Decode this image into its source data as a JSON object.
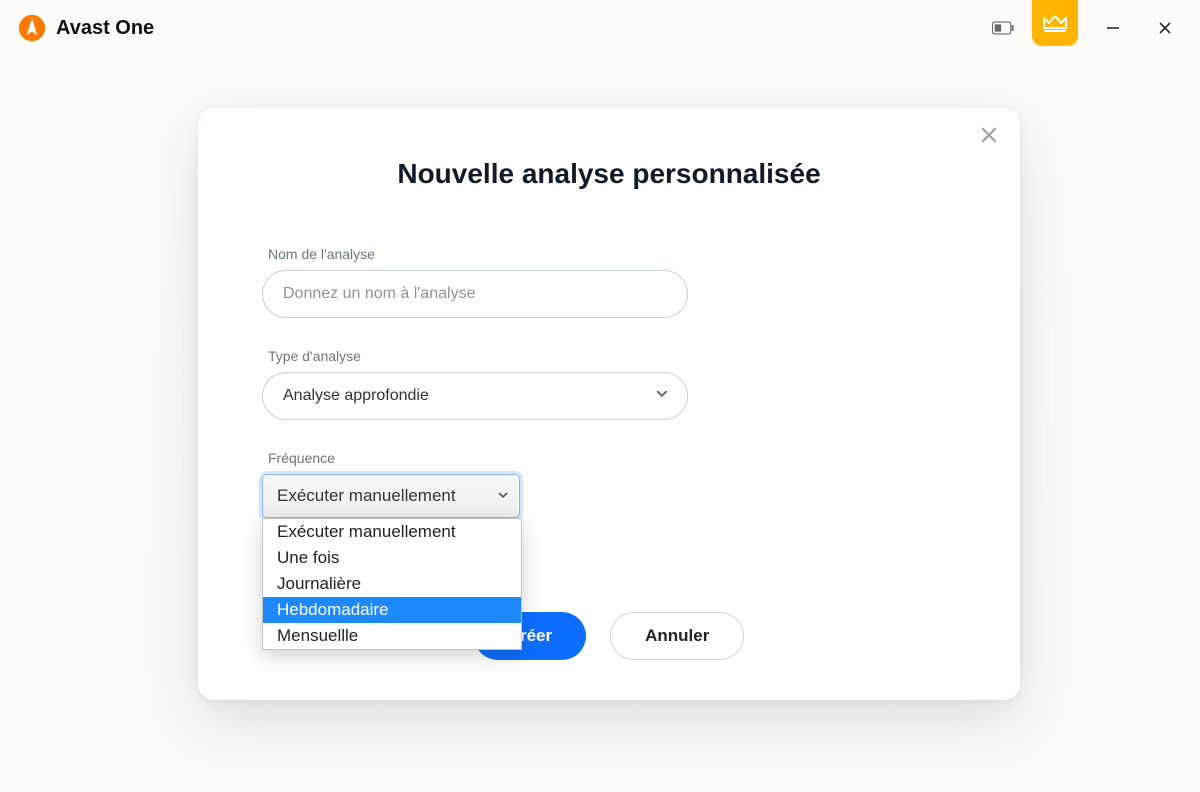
{
  "app": {
    "title": "Avast One"
  },
  "modal": {
    "title": "Nouvelle analyse personnalisée",
    "fields": {
      "name_label": "Nom de l'analyse",
      "name_placeholder": "Donnez un nom à l'analyse",
      "type_label": "Type d'analyse",
      "type_value": "Analyse approfondie",
      "freq_label": "Fréquence",
      "freq_value": "Exécuter manuellement",
      "freq_options": [
        "Exécuter manuellement",
        "Une fois",
        "Journalière",
        "Hebdomadaire",
        "Mensuellle"
      ],
      "freq_highlight_index": 3
    },
    "buttons": {
      "create": "Créer",
      "cancel": "Annuler"
    }
  }
}
